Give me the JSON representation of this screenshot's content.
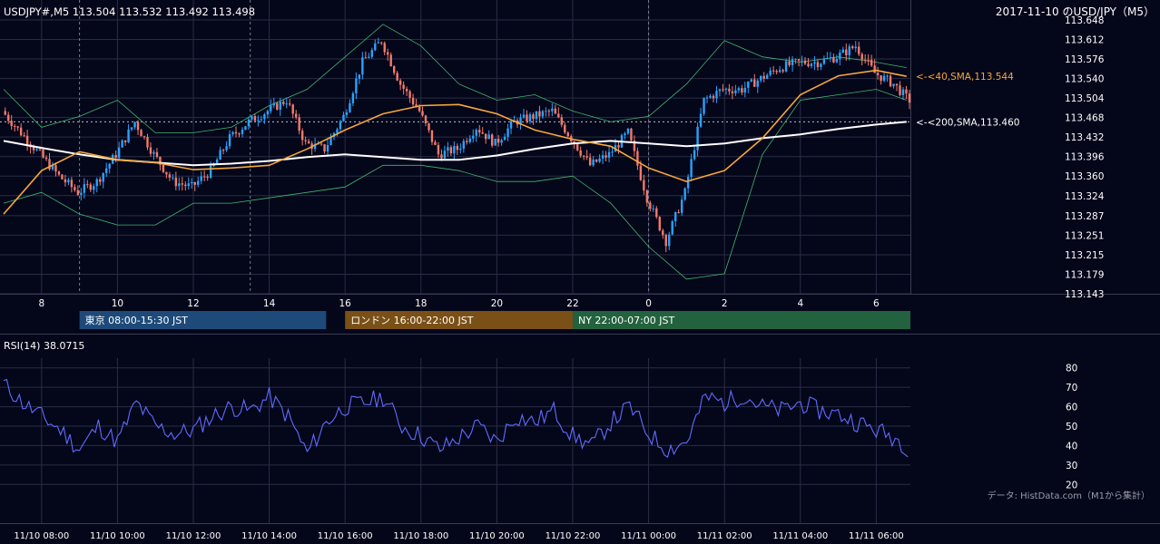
{
  "header": {
    "symbol_text": "USDJPY#,M5 113.504 113.532 113.492 113.498",
    "title": "2017-11-10 のUSD/JPY（M5）"
  },
  "colors": {
    "background": "#04061a",
    "candle_up": "#29a3ff",
    "candle_down": "#f47a6a",
    "sma40": "#f7a73a",
    "sma200": "#ffffff",
    "bollinger": "#3fb86c",
    "rsi": "#5f6cff",
    "grid": "#2a2d45",
    "tokyo": "#1e4a7a",
    "london": "#7a5016",
    "ny": "#23623e"
  },
  "sessions": [
    {
      "label": "東京 08:00-15:30 JST",
      "color": "#1e4a7a"
    },
    {
      "label": "ロンドン 16:00-22:00 JST",
      "color": "#7a5016"
    },
    {
      "label": "NY 22:00-07:00 JST",
      "color": "#23623e"
    }
  ],
  "rsi_label": "RSI(14) 38.0715",
  "source": "データ: HistData.com（M1から集計）",
  "chart_data": [
    {
      "type": "candlestick",
      "title": "2017-11-10 のUSD/JPY（M5）",
      "ylim": [
        113.143,
        113.648
      ],
      "y_ticks": [
        "113.648",
        "113.612",
        "113.576",
        "113.540",
        "113.504",
        "113.468",
        "113.432",
        "113.396",
        "113.360",
        "113.324",
        "113.287",
        "113.251",
        "113.215",
        "113.179",
        "113.143"
      ],
      "x_ticks": [
        "8",
        "10",
        "12",
        "14",
        "16",
        "18",
        "20",
        "22",
        "0",
        "2",
        "4",
        "6"
      ],
      "x_tick_hours": [
        8,
        10,
        12,
        14,
        16,
        18,
        20,
        22,
        24,
        26,
        28,
        30
      ],
      "x_range_hours": [
        7.0,
        30.9
      ],
      "day_separators_hours": [
        9,
        13.5,
        24
      ],
      "series": [
        {
          "name": "SMA(40)",
          "label": "<-<40,SMA,113.544",
          "last": 113.544,
          "x": [
            7,
            8,
            9,
            10,
            11,
            12,
            13,
            14,
            15,
            16,
            17,
            18,
            19,
            20,
            21,
            22,
            23,
            24,
            25,
            26,
            27,
            28,
            29,
            30,
            30.8
          ],
          "values": [
            113.29,
            113.37,
            113.405,
            113.39,
            113.385,
            113.372,
            113.375,
            113.38,
            113.41,
            113.445,
            113.475,
            113.49,
            113.492,
            113.475,
            113.445,
            113.428,
            113.415,
            113.375,
            113.35,
            113.37,
            113.43,
            113.51,
            113.545,
            113.555,
            113.544
          ]
        },
        {
          "name": "SMA(200)",
          "label": "<-<200,SMA,113.460",
          "last": 113.46,
          "x": [
            7,
            8,
            9,
            10,
            11,
            12,
            13,
            14,
            15,
            16,
            17,
            18,
            19,
            20,
            21,
            22,
            23,
            24,
            25,
            26,
            27,
            28,
            29,
            30,
            30.8
          ],
          "values": [
            113.425,
            113.412,
            113.4,
            113.39,
            113.385,
            113.38,
            113.383,
            113.388,
            113.395,
            113.4,
            113.395,
            113.39,
            113.39,
            113.398,
            113.41,
            113.42,
            113.425,
            113.42,
            113.415,
            113.42,
            113.43,
            113.437,
            113.447,
            113.455,
            113.46
          ]
        }
      ],
      "bollinger_upper": {
        "x": [
          7,
          8,
          9,
          10,
          11,
          12,
          13,
          14,
          15,
          16,
          17,
          18,
          19,
          20,
          21,
          22,
          23,
          24,
          25,
          26,
          27,
          28,
          29,
          30,
          30.8
        ],
        "values": [
          113.52,
          113.45,
          113.47,
          113.5,
          113.44,
          113.44,
          113.45,
          113.49,
          113.52,
          113.58,
          113.64,
          113.6,
          113.53,
          113.5,
          113.51,
          113.48,
          113.46,
          113.47,
          113.53,
          113.61,
          113.58,
          113.57,
          113.58,
          113.57,
          113.56
        ]
      },
      "bollinger_lower": {
        "x": [
          7,
          8,
          9,
          10,
          11,
          12,
          13,
          14,
          15,
          16,
          17,
          18,
          19,
          20,
          21,
          22,
          23,
          24,
          25,
          26,
          27,
          28,
          29,
          30,
          30.8
        ],
        "values": [
          113.31,
          113.33,
          113.29,
          113.27,
          113.27,
          113.31,
          113.31,
          113.32,
          113.33,
          113.34,
          113.38,
          113.38,
          113.37,
          113.35,
          113.35,
          113.36,
          113.31,
          113.23,
          113.17,
          113.18,
          113.4,
          113.5,
          113.51,
          113.52,
          113.5
        ],
        "note_x": [
          25.6,
          26.1
        ],
        "note_values": [
          113.155,
          113.16
        ]
      },
      "candles_path": {
        "x": [
          7.0,
          7.5,
          8.0,
          8.5,
          9.0,
          9.5,
          10.0,
          10.5,
          11.0,
          11.5,
          12.0,
          12.5,
          13.0,
          13.5,
          14.0,
          14.5,
          15.0,
          15.5,
          16.0,
          16.5,
          17.0,
          17.5,
          18.0,
          18.5,
          19.0,
          19.5,
          20.0,
          20.5,
          21.0,
          21.5,
          22.0,
          22.5,
          23.0,
          23.5,
          24.0,
          24.5,
          25.0,
          25.5,
          26.0,
          26.5,
          27.0,
          27.5,
          28.0,
          28.5,
          29.0,
          29.5,
          30.0,
          30.5,
          30.9
        ],
        "values": [
          113.48,
          113.44,
          113.4,
          113.36,
          113.33,
          113.35,
          113.4,
          113.46,
          113.4,
          113.35,
          113.34,
          113.37,
          113.43,
          113.46,
          113.48,
          113.5,
          113.42,
          113.41,
          113.47,
          113.57,
          113.61,
          113.53,
          113.48,
          113.4,
          113.41,
          113.45,
          113.42,
          113.46,
          113.47,
          113.48,
          113.43,
          113.38,
          113.4,
          113.44,
          113.32,
          113.24,
          113.33,
          113.5,
          113.52,
          113.52,
          113.54,
          113.56,
          113.57,
          113.57,
          113.58,
          113.6,
          113.55,
          113.53,
          113.5
        ]
      }
    },
    {
      "type": "line",
      "name": "RSI(14)",
      "ylim": [
        15,
        85
      ],
      "y_ticks": [
        "80",
        "70",
        "60",
        "50",
        "40",
        "30",
        "20"
      ],
      "x_ticks": [
        "11/10 08:00",
        "11/10 10:00",
        "11/10 12:00",
        "11/10 14:00",
        "11/10 16:00",
        "11/10 18:00",
        "11/10 20:00",
        "11/10 22:00",
        "11/11 00:00",
        "11/11 02:00",
        "11/11 04:00",
        "11/11 06:00"
      ],
      "x": [
        7.0,
        7.5,
        8.0,
        8.5,
        9.0,
        9.5,
        10.0,
        10.5,
        11.0,
        11.5,
        12.0,
        12.5,
        13.0,
        13.5,
        14.0,
        14.5,
        15.0,
        15.5,
        16.0,
        16.5,
        17.0,
        17.5,
        18.0,
        18.5,
        19.0,
        19.5,
        20.0,
        20.5,
        21.0,
        21.5,
        22.0,
        22.5,
        23.0,
        23.5,
        24.0,
        24.5,
        25.0,
        25.5,
        26.0,
        26.5,
        27.0,
        27.5,
        28.0,
        28.5,
        29.0,
        29.5,
        30.0,
        30.5,
        30.9
      ],
      "values": [
        72,
        62,
        55,
        48,
        38,
        50,
        42,
        62,
        50,
        46,
        48,
        55,
        60,
        58,
        65,
        55,
        36,
        52,
        60,
        62,
        65,
        50,
        45,
        38,
        44,
        50,
        42,
        55,
        52,
        58,
        45,
        40,
        52,
        60,
        46,
        38,
        42,
        65,
        62,
        66,
        60,
        58,
        62,
        58,
        56,
        52,
        48,
        44,
        38
      ]
    }
  ]
}
